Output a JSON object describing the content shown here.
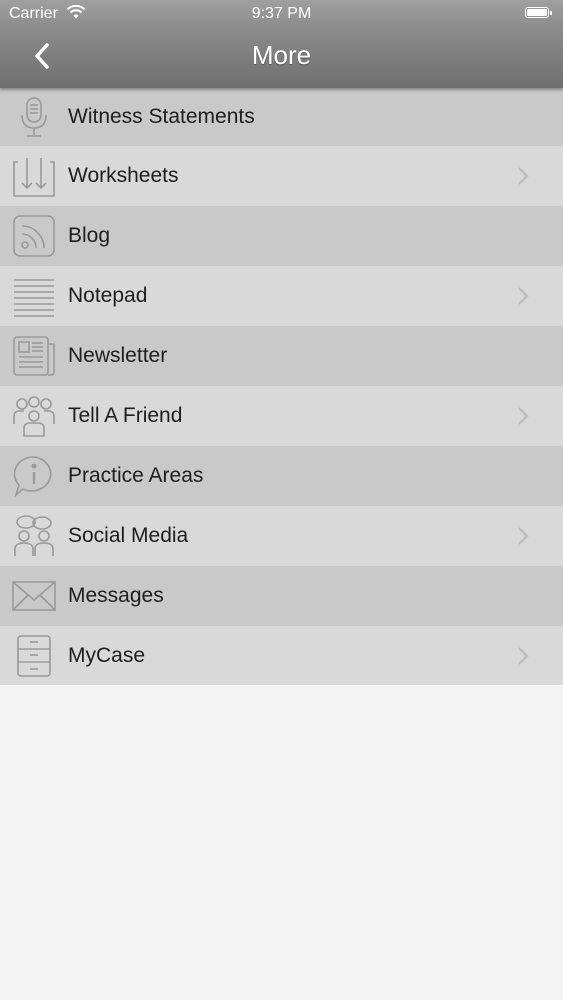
{
  "status_bar": {
    "carrier": "Carrier",
    "time": "9:37 PM"
  },
  "nav": {
    "title": "More",
    "back_icon": "chevron-left-icon"
  },
  "menu": {
    "items": [
      {
        "label": "Witness Statements",
        "icon": "microphone-icon",
        "chevron": false
      },
      {
        "label": "Worksheets",
        "icon": "download-arrows-icon",
        "chevron": true
      },
      {
        "label": "Blog",
        "icon": "rss-icon",
        "chevron": false
      },
      {
        "label": "Notepad",
        "icon": "notepad-lines-icon",
        "chevron": true
      },
      {
        "label": "Newsletter",
        "icon": "newspaper-icon",
        "chevron": false
      },
      {
        "label": "Tell A Friend",
        "icon": "people-icon",
        "chevron": true
      },
      {
        "label": "Practice Areas",
        "icon": "info-bubble-icon",
        "chevron": false
      },
      {
        "label": "Social Media",
        "icon": "chat-people-icon",
        "chevron": true
      },
      {
        "label": "Messages",
        "icon": "envelope-icon",
        "chevron": false
      },
      {
        "label": "MyCase",
        "icon": "file-cabinet-icon",
        "chevron": true
      }
    ]
  },
  "colors": {
    "header_top": "#a0a0a0",
    "header_bottom": "#6f6f6f",
    "row_dark": "#c9c9c9",
    "row_light": "#d9d9d9",
    "icon_stroke": "#9a9a9a",
    "background": "#f3f3f3"
  }
}
